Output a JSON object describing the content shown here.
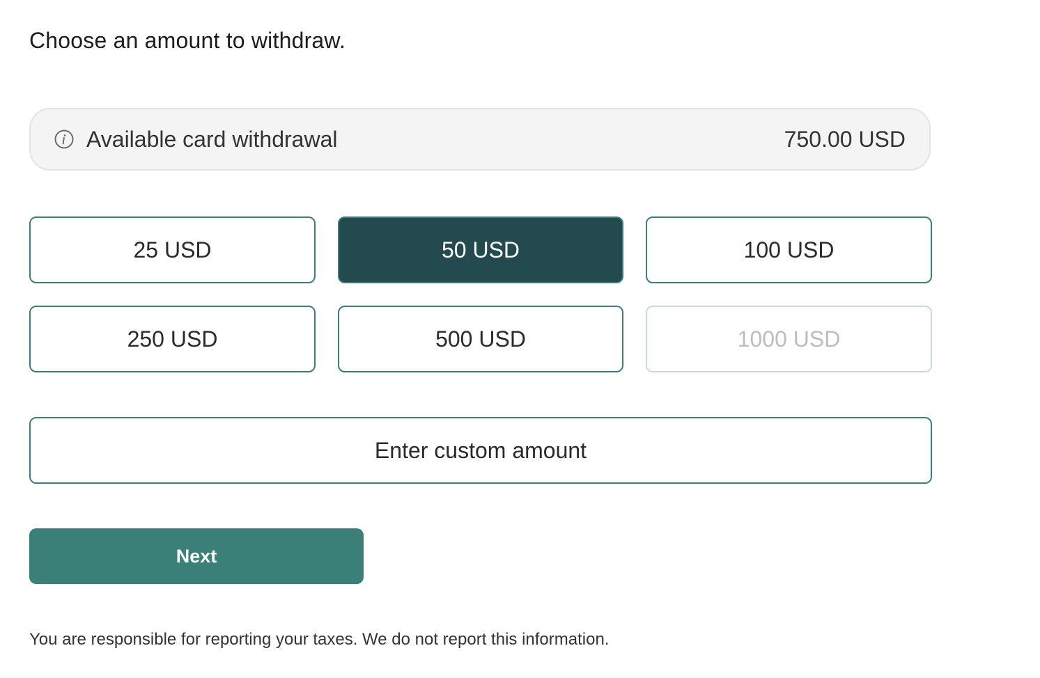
{
  "heading": "Choose an amount to withdraw.",
  "available": {
    "label": "Available card withdrawal",
    "value": "750.00 USD",
    "icon": "info-icon"
  },
  "amounts": [
    {
      "label": "25 USD",
      "state": "default"
    },
    {
      "label": "50 USD",
      "state": "selected"
    },
    {
      "label": "100 USD",
      "state": "default"
    },
    {
      "label": "250 USD",
      "state": "default"
    },
    {
      "label": "500 USD",
      "state": "default"
    },
    {
      "label": "1000 USD",
      "state": "disabled"
    }
  ],
  "custom_amount_label": "Enter custom amount",
  "next_label": "Next",
  "disclaimer": "You are responsible for reporting your taxes. We do not report this information.",
  "colors": {
    "accent": "#3a8079",
    "selected_bg": "#234a4f",
    "disabled_text": "#bdbdbd",
    "info_bg": "#f4f4f4"
  }
}
